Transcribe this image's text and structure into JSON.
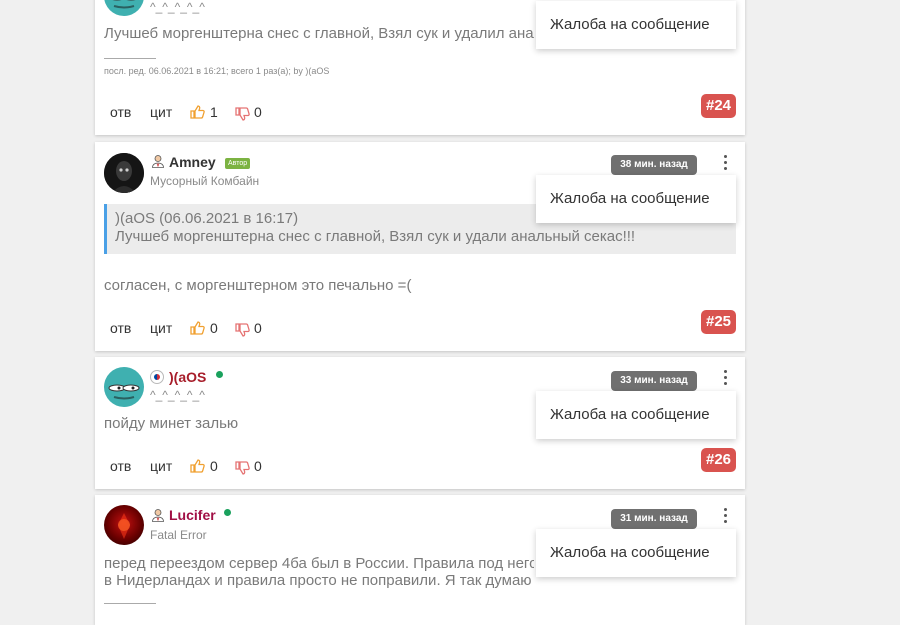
{
  "menu_label": "Жалоба на сообщение",
  "actions": {
    "reply": "отв",
    "quote": "цит"
  },
  "posts": [
    {
      "number": "#24",
      "user_status": "^_^_^_^_^",
      "body": "Лучшеб моргенштерна снес с главной, Взял сук и удалил анальный секас!!!",
      "edit_note": "посл. ред. 06.06.2021 в 16:21; всего 1 раз(а); by )(aOS",
      "likes": "1",
      "dislikes": "0"
    },
    {
      "number": "#25",
      "username": "Amney",
      "badge": "Автор",
      "user_title": "Мусорный Комбайн",
      "time": "38 мин. назад",
      "quote_author": ")(aOS (06.06.2021 в 16:17)",
      "quote_text": "Лучшеб моргенштерна снес с главной, Взял сук и удали анальный секас!!!",
      "body": "согласен, с моргенштерном это печально =(",
      "likes": "0",
      "dislikes": "0"
    },
    {
      "number": "#26",
      "username": ")(aOS",
      "user_status": "^_^_^_^_^",
      "time": "33 мин. назад",
      "body": "пойду минет залью",
      "likes": "0",
      "dislikes": "0"
    },
    {
      "username": "Lucifer",
      "user_title": "Fatal Error",
      "time": "31 мин. назад",
      "body_line1": "перед переездом сервер 4ба был в России. Правила под него и писали...",
      "body_line2": "в Нидерландах и правила просто не поправили. Я так думаю"
    }
  ],
  "colors": {
    "post_number_bg": "#d9534f",
    "time_badge_bg": "#707070",
    "author_badge_bg": "#7cb342",
    "online": "#1aa15d",
    "quote_border": "#4aa0e6",
    "like": "#f0a030",
    "dislike": "#e57373"
  }
}
